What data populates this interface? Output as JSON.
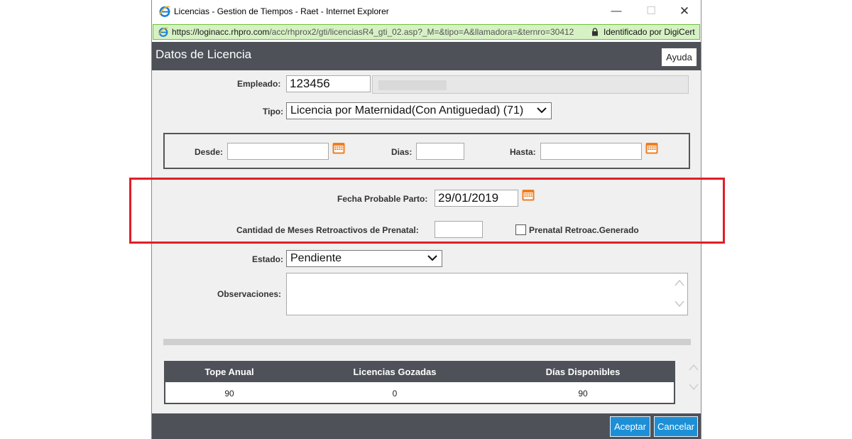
{
  "window": {
    "title": "Licencias - Gestion de Tiempos - Raet - Internet Explorer",
    "url_host": "https://loginacc.rhpro.com",
    "url_path": "/acc/rhprox2/gti/licenciasR4_gti_02.asp?_M=&tipo=A&llamadora=&ternro=30412",
    "identity": "Identificado por DigiCert"
  },
  "header": {
    "title": "Datos de Licencia",
    "help_label": "Ayuda"
  },
  "form": {
    "empleado_label": "Empleado:",
    "empleado_value": "123456",
    "tipo_label": "Tipo:",
    "tipo_value": "Licencia por Maternidad(Con Antiguedad) (71)",
    "desde_label": "Desde:",
    "desde_value": "",
    "dias_label": "Dias:",
    "dias_value": "",
    "hasta_label": "Hasta:",
    "hasta_value": "",
    "fecha_parto_label": "Fecha Probable Parto:",
    "fecha_parto_value": "29/01/2019",
    "meses_label": "Cantidad de Meses Retroactivos de Prenatal:",
    "meses_value": "",
    "prenatal_label": "Prenatal Retroac.Generado",
    "prenatal_checked": false,
    "estado_label": "Estado:",
    "estado_value": "Pendiente",
    "observaciones_label": "Observaciones:",
    "observaciones_value": ""
  },
  "summary_table": {
    "headers": [
      "Tope Anual",
      "Licencias Gozadas",
      "Días Disponibles"
    ],
    "row": [
      "90",
      "0",
      "90"
    ]
  },
  "footer": {
    "accept_label": "Aceptar",
    "cancel_label": "Cancelar"
  },
  "colors": {
    "header_band": "#4e5158",
    "accent_orange": "#f07d1e",
    "button_blue": "#1d8fd6",
    "highlight_red": "#e01f26",
    "address_bar_green": "#d6f1c4"
  },
  "icons": {
    "title_icon": "ie-logo-icon",
    "calendar_icon": "calendar-icon",
    "lock_icon": "lock-icon"
  }
}
